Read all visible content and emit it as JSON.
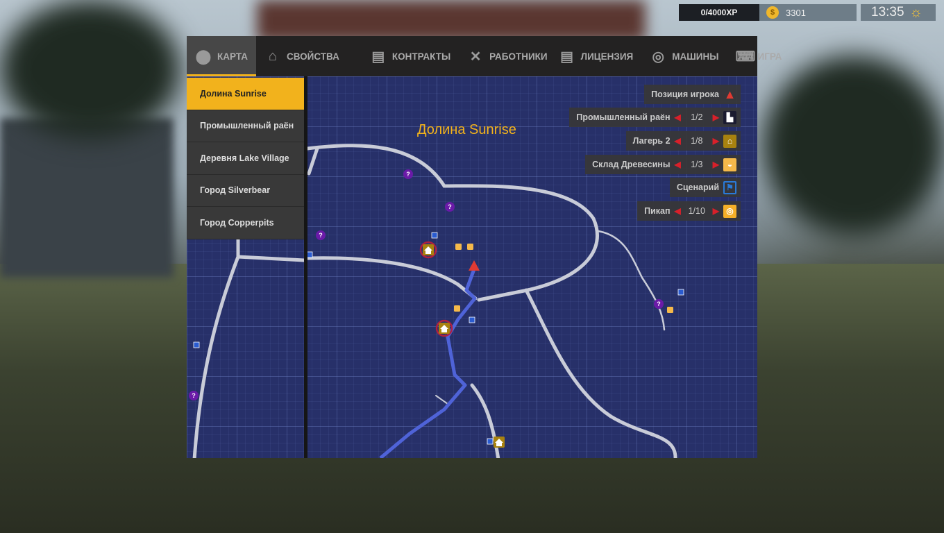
{
  "hud": {
    "xp": "0/4000XP",
    "money": "3301",
    "coin_symbol": "$",
    "time": "13:35",
    "weather_icon": "sun-icon"
  },
  "tabs": [
    {
      "label": "КАРТА",
      "icon": "map-pin-icon",
      "active": true
    },
    {
      "label": "СВОЙСТВА",
      "icon": "house-icon"
    },
    {
      "label": "КОНТРАКТЫ",
      "icon": "notebook-icon"
    },
    {
      "label": "РАБОТНИКИ",
      "icon": "tools-icon"
    },
    {
      "label": "ЛИЦЕНЗИЯ",
      "icon": "notebook-icon"
    },
    {
      "label": "МАШИНЫ",
      "icon": "steering-wheel-icon"
    },
    {
      "label": "ИГРА",
      "icon": "keyboard-icon"
    }
  ],
  "regions": [
    "Долина Sunrise",
    "Промышленный раён",
    "Деревня Lake Village",
    "Город Silverbear",
    "Город Copperpits"
  ],
  "map": {
    "title": "Долина Sunrise"
  },
  "legend": [
    {
      "label": "Позиция игрока",
      "count": null
    },
    {
      "label": "Промышленный раён",
      "count": "1/2"
    },
    {
      "label": "Лагерь 2",
      "count": "1/8"
    },
    {
      "label": "Склад Древесины",
      "count": "1/3"
    },
    {
      "label": "Сценарий",
      "count": null
    },
    {
      "label": "Пикап",
      "count": "1/10"
    }
  ],
  "colors": {
    "accent": "#f2b21c",
    "map_bg": "#273069",
    "road": "#c9ccd8",
    "route": "#4f63d8",
    "player": "#e03a32",
    "mystery": "#6a1aa8"
  }
}
